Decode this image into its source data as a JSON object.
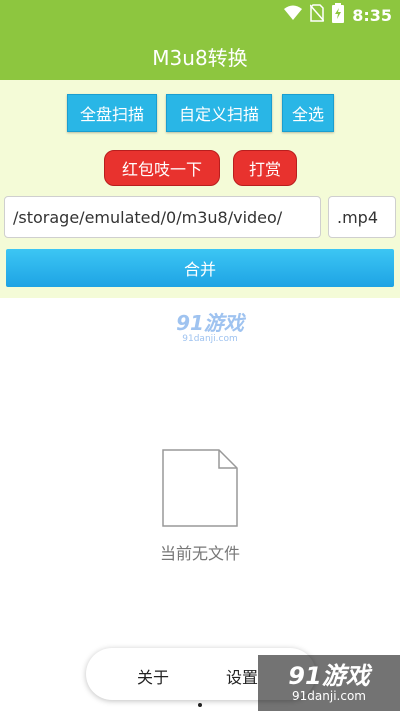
{
  "status": {
    "time": "8:35"
  },
  "app": {
    "title": "M3u8转换"
  },
  "toolbar": {
    "scan_all": "全盘扫描",
    "custom_scan": "自定义扫描",
    "select_all": "全选",
    "red_packet": "红包吱一下",
    "tip": "打赏"
  },
  "path": {
    "value": "/storage/emulated/0/m3u8/video/"
  },
  "extension": {
    "value": ".mp4"
  },
  "merge": {
    "label": "合并"
  },
  "watermark": {
    "title": "91游戏",
    "url": "91danji.com"
  },
  "empty": {
    "text": "当前无文件"
  },
  "nav": {
    "about": "关于",
    "settings": "设置"
  },
  "brand": {
    "title": "91游戏",
    "url": "91danji.com"
  },
  "colors": {
    "appbar": "#8dc63f",
    "panel": "#f4fbd7",
    "blue_button": "#29b6e6",
    "red_button": "#e8322e"
  }
}
